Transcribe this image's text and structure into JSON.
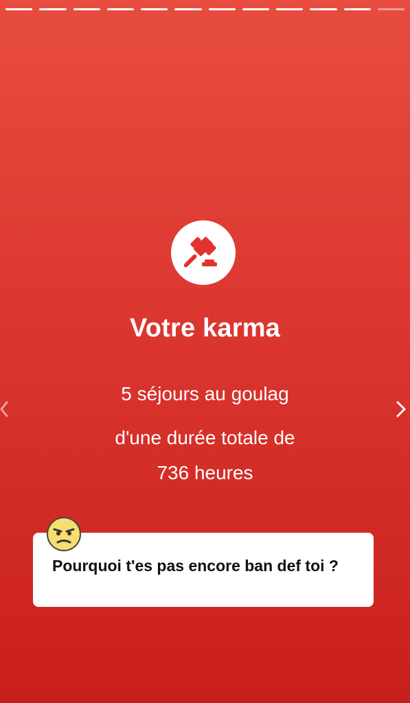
{
  "story": {
    "segments_total": 12,
    "segments_completed": 11
  },
  "card": {
    "title": "Votre karma",
    "line1_count": "5",
    "line1_text": "séjours au goulag",
    "line2": "d'une durée totale de",
    "line3_hours": "736",
    "line3_unit": "heures"
  },
  "comment": {
    "text": "Pourquoi t'es pas encore ban def toi ?"
  },
  "icons": {
    "main": "gavel-icon",
    "emoji": "angry-face-icon",
    "prev": "chevron-left-icon",
    "next": "chevron-right-icon"
  },
  "colors": {
    "background_top": "#e84c3f",
    "background_bottom": "#c91f1c",
    "accent": "#e2332d",
    "text_on_bg": "#ffffff"
  }
}
